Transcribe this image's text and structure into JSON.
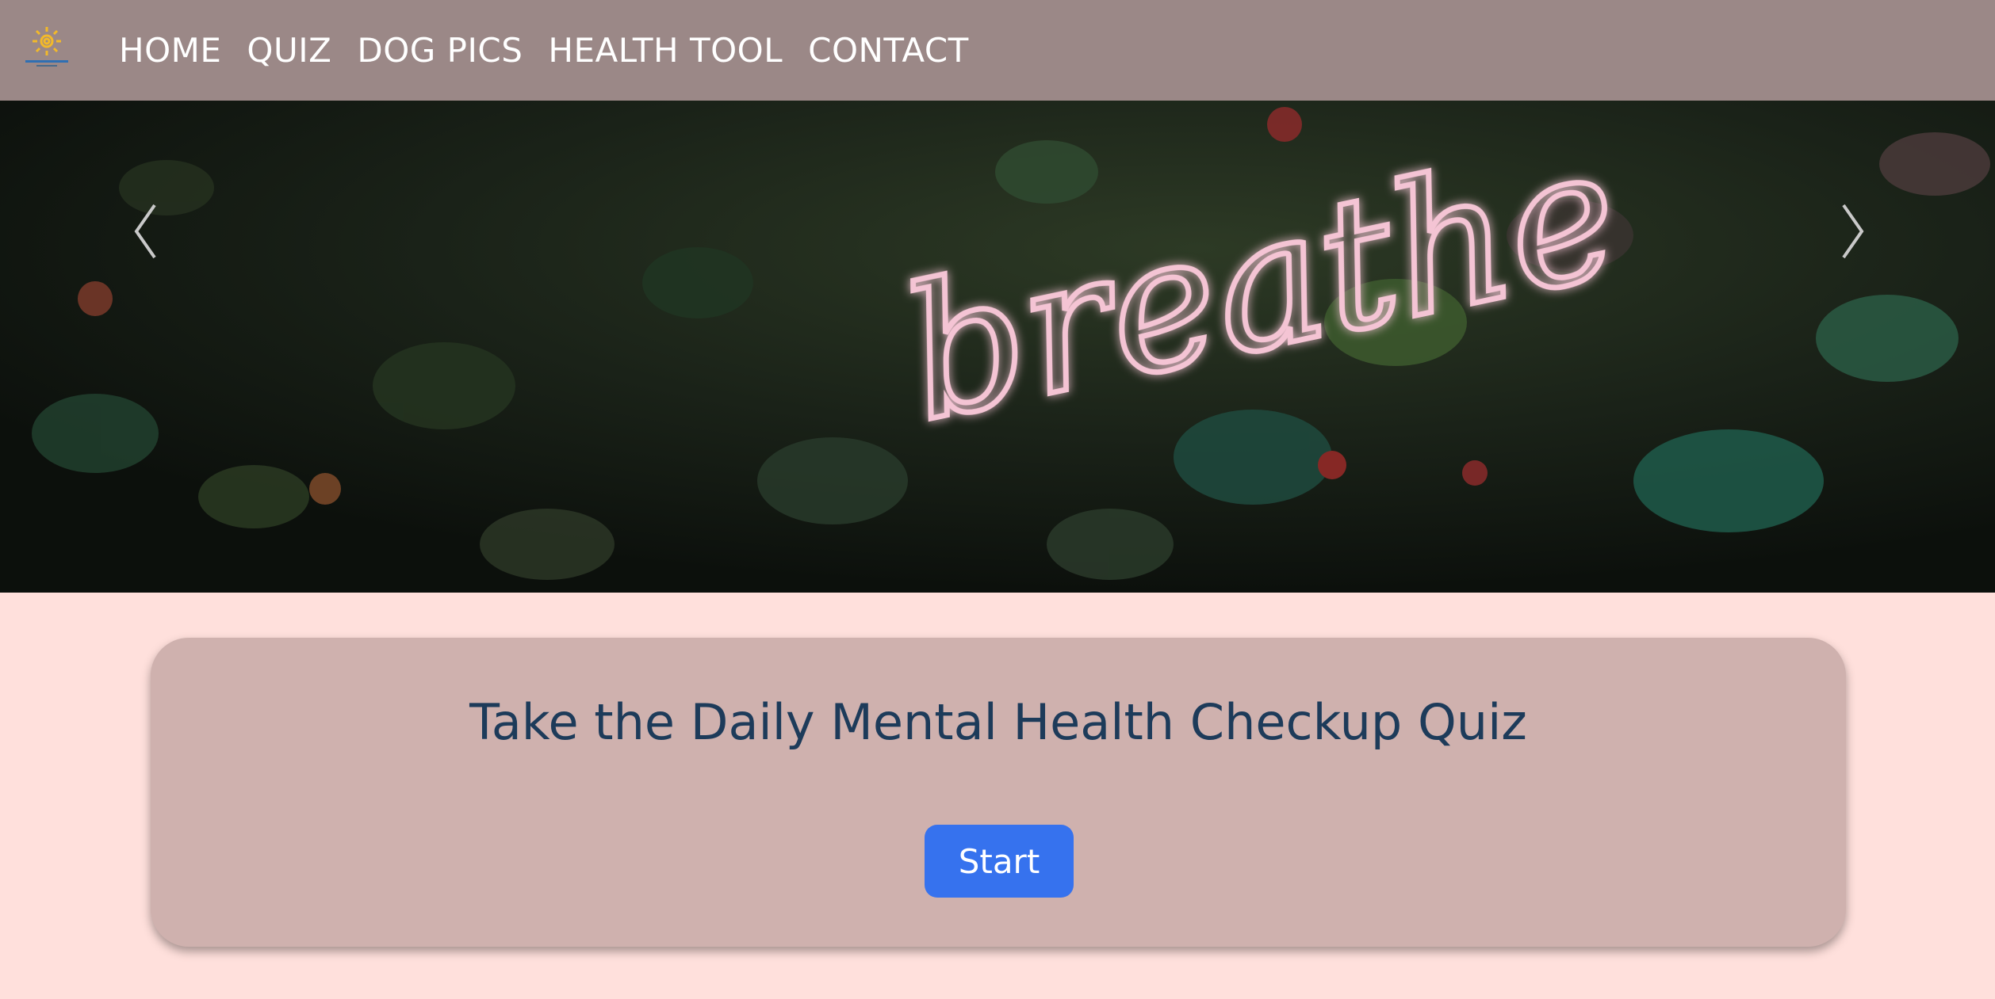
{
  "nav": {
    "links": [
      "HOME",
      "QUIZ",
      "DOG PICS",
      "HEALTH TOOL",
      "CONTACT"
    ]
  },
  "hero": {
    "neon_text": "breathe"
  },
  "quiz": {
    "title": "Take the Daily Mental Health Checkup Quiz",
    "start_label": "Start"
  },
  "colors": {
    "navbar": "#9b8887",
    "page_bg": "#ffe0dc",
    "card_bg": "#cfb1ae",
    "title_text": "#1d3b5a",
    "button": "#3672ee"
  },
  "icons": {
    "logo": "sun-logo-icon",
    "prev": "chevron-left-icon",
    "next": "chevron-right-icon"
  }
}
